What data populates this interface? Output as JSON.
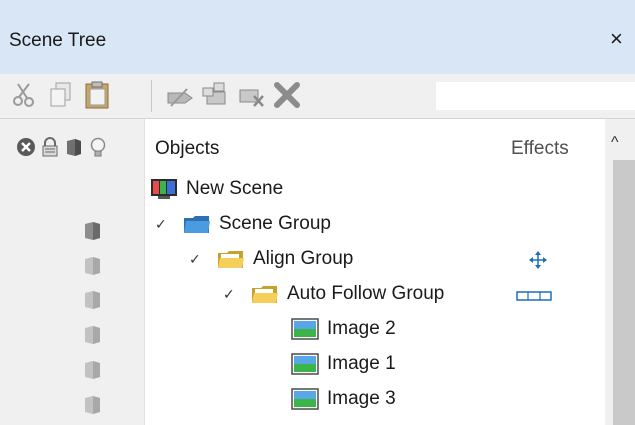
{
  "window": {
    "title": "Scene Tree",
    "close_glyph": "×"
  },
  "toolbar": {
    "buttons": [
      {
        "name": "cut-icon"
      },
      {
        "name": "copy-icon"
      },
      {
        "name": "paste-icon"
      },
      {
        "name": "rename-icon"
      },
      {
        "name": "group-icon"
      },
      {
        "name": "ungroup-icon"
      },
      {
        "name": "delete-icon"
      }
    ],
    "search_value": ""
  },
  "columns": {
    "objects": "Objects",
    "effects": "Effects",
    "header_icons": [
      "disable-icon",
      "lock-icon",
      "visibility-icon",
      "light-icon"
    ]
  },
  "scroll_up_glyph": "^",
  "tree": [
    {
      "label": "New Scene",
      "icon": "scene-icon",
      "expanded": null,
      "depth": 0,
      "effect": null
    },
    {
      "label": "Scene Group",
      "icon": "blue-folder-icon",
      "expanded": true,
      "depth": 0,
      "effect": null
    },
    {
      "label": "Align Group",
      "icon": "yellow-folder-icon",
      "expanded": true,
      "depth": 1,
      "effect": "move-arrows-icon"
    },
    {
      "label": "Auto Follow Group",
      "icon": "yellow-folder-icon",
      "expanded": true,
      "depth": 2,
      "effect": "rectangle-outline-icon"
    },
    {
      "label": "Image 2",
      "icon": "image-icon",
      "expanded": null,
      "depth": 3,
      "effect": null
    },
    {
      "label": "Image 1",
      "icon": "image-icon",
      "expanded": null,
      "depth": 3,
      "effect": null
    },
    {
      "label": "Image 3",
      "icon": "image-icon",
      "expanded": null,
      "depth": 3,
      "effect": null
    }
  ],
  "colors": {
    "titlebar": "#d8e6f5",
    "blue_folder": "#4a8fd1",
    "yellow_folder": "#f2c94c",
    "accent_blue": "#1d6fb8"
  }
}
